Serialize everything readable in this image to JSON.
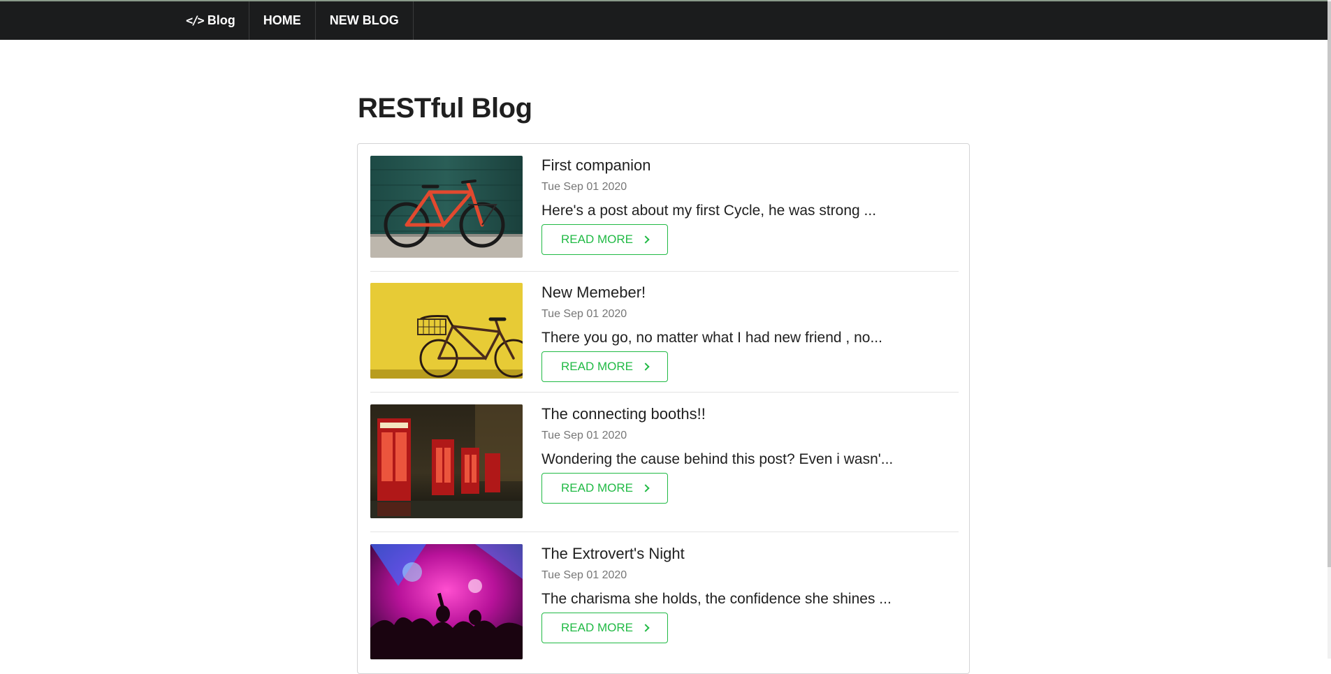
{
  "nav": {
    "brand_label": "Blog",
    "brand_icon": "code-icon",
    "items": [
      {
        "label": "HOME"
      },
      {
        "label": "NEW BLOG"
      }
    ]
  },
  "page": {
    "title": "RESTful Blog"
  },
  "colors": {
    "navbar_bg": "#1b1c1d",
    "accent_green": "#21ba45",
    "date_gray": "#767676"
  },
  "posts": [
    {
      "title": "First companion",
      "date": "Tue Sep 01 2020",
      "excerpt": "Here's a post about my first Cycle, he was strong ...",
      "button_label": "READ MORE",
      "image": "orange-bicycle-photo"
    },
    {
      "title": "New Memeber!",
      "date": "Tue Sep 01 2020",
      "excerpt": "There you go, no matter what I had new friend , no...",
      "button_label": "READ MORE",
      "image": "bicycle-yellow-wall-photo"
    },
    {
      "title": "The connecting booths!!",
      "date": "Tue Sep 01 2020",
      "excerpt": "Wondering the cause behind this post? Even i wasn'...",
      "button_label": "READ MORE",
      "image": "red-phone-booths-photo"
    },
    {
      "title": "The Extrovert's Night",
      "date": "Tue Sep 01 2020",
      "excerpt": "The charisma she holds, the confidence she shines ...",
      "button_label": "READ MORE",
      "image": "concert-crowd-photo"
    }
  ]
}
